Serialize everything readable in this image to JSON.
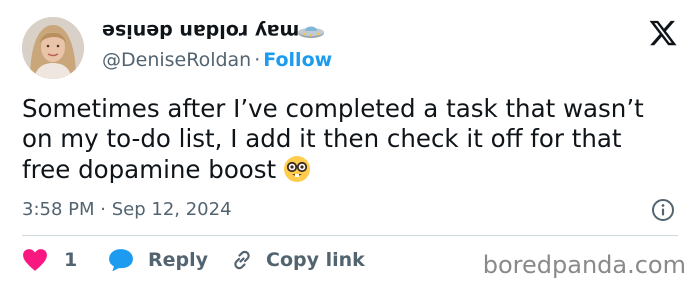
{
  "author": {
    "display_name": "may roldan denise",
    "handle": "@DeniseRoldan",
    "separator": "·",
    "follow_label": "Follow",
    "name_emoji": "ufo-icon"
  },
  "tweet": {
    "lines": [
      "Sometimes after I’ve completed a task that wasn’t",
      "on my to-do list, I add it then check it off for that",
      "free dopamine boost"
    ],
    "trailing_emoji": "nerd-face-icon"
  },
  "meta": {
    "time": "3:58 PM",
    "separator": "·",
    "date": "Sep 12, 2024"
  },
  "actions": {
    "like_count": "1",
    "reply_label": "Reply",
    "copy_label": "Copy link"
  },
  "watermark": "boredpanda.com",
  "colors": {
    "text": "#0f1419",
    "secondary": "#536471",
    "accent": "#1d9bf0",
    "like": "#f91880",
    "reply": "#1d9bf0",
    "divider": "#cfd9de"
  }
}
